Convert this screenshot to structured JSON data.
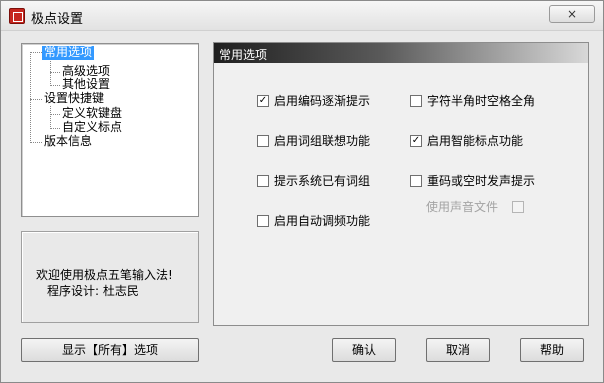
{
  "window": {
    "title": "极点设置",
    "close_label": "×"
  },
  "tree": {
    "items": [
      {
        "label": "常用选项",
        "selected": true
      },
      {
        "label": "高级选项"
      },
      {
        "label": "其他设置"
      },
      {
        "label": "设置快捷键"
      },
      {
        "label": "定义软键盘"
      },
      {
        "label": "自定义标点"
      },
      {
        "label": "版本信息"
      }
    ]
  },
  "welcome": {
    "line1": "欢迎使用极点五笔输入法!",
    "line2": "程序设计: 杜志民"
  },
  "panel": {
    "title": "常用选项",
    "options": [
      {
        "label": "启用编码逐渐提示",
        "checked": true
      },
      {
        "label": "字符半角时空格全角",
        "checked": false
      },
      {
        "label": "启用词组联想功能",
        "checked": false
      },
      {
        "label": "启用智能标点功能",
        "checked": true
      },
      {
        "label": "提示系统已有词组",
        "checked": false
      },
      {
        "label": "重码或空时发声提示",
        "checked": false
      },
      {
        "label": "使用声音文件",
        "checked": false,
        "disabled": true
      },
      {
        "label": "启用自动调频功能",
        "checked": false
      }
    ]
  },
  "buttons": {
    "show_all": "显示【所有】选项",
    "ok": "确认",
    "cancel": "取消",
    "help": "帮助"
  }
}
